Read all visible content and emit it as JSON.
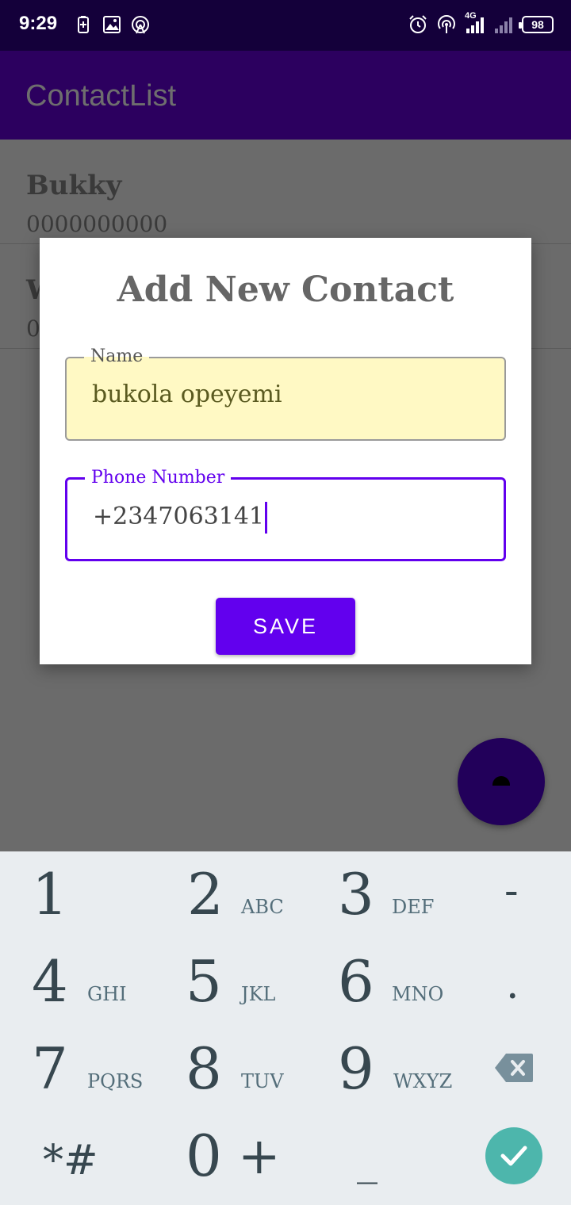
{
  "status_bar": {
    "time": "9:29",
    "network_label": "4G",
    "battery": "98"
  },
  "app_bar": {
    "title": "ContactList"
  },
  "contacts": [
    {
      "name": "Bukky",
      "phone": "0000000000"
    },
    {
      "name": "W",
      "phone": "0"
    }
  ],
  "dialog": {
    "title": "Add New Contact",
    "name_label": "Name",
    "name_value": "bukola opeyemi",
    "phone_label": "Phone Number",
    "phone_value": "+2347063141",
    "save_label": "SAVE"
  },
  "keyboard": {
    "keys": [
      {
        "digit": "1",
        "letters": ""
      },
      {
        "digit": "2",
        "letters": "ABC"
      },
      {
        "digit": "3",
        "letters": "DEF"
      },
      {
        "digit": "-",
        "letters": ""
      },
      {
        "digit": "4",
        "letters": "GHI"
      },
      {
        "digit": "5",
        "letters": "JKL"
      },
      {
        "digit": "6",
        "letters": "MNO"
      },
      {
        "digit": ".",
        "letters": ""
      },
      {
        "digit": "7",
        "letters": "PQRS"
      },
      {
        "digit": "8",
        "letters": "TUV"
      },
      {
        "digit": "9",
        "letters": "WXYZ"
      },
      {
        "digit": "*#",
        "letters": ""
      },
      {
        "digit": "0",
        "letters": ""
      },
      {
        "digit": "+",
        "letters": ""
      },
      {
        "digit": "_",
        "letters": ""
      }
    ]
  },
  "colors": {
    "status_bar": "#14003a",
    "app_bar": "#2c005f",
    "accent": "#6200ee",
    "fab": "#22005a",
    "name_field_bg": "#fff9c4",
    "keyboard_bg": "#e9edf0",
    "done_key": "#4db6ac"
  },
  "icons": {
    "status_left": [
      "battery-saver-icon",
      "image-icon",
      "hotspot-icon"
    ],
    "status_right": [
      "alarm-icon",
      "wifi-hotspot-icon",
      "signal-icon",
      "signal-weak-icon",
      "battery-icon"
    ],
    "keyboard": [
      "backspace-icon",
      "check-icon"
    ]
  }
}
